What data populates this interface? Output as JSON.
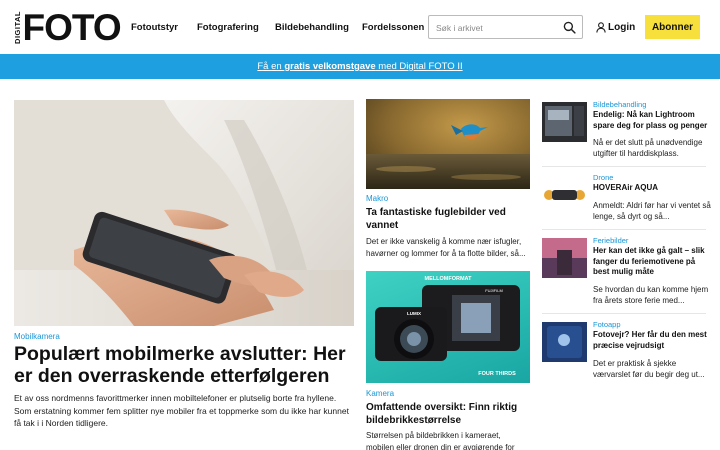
{
  "header": {
    "logo_small": "DIGITAL",
    "logo_big": "FOTO",
    "nav": [
      "Fotoutstyr",
      "Fotografering",
      "Bildebehandling",
      "Fordelssonen"
    ],
    "search_placeholder": "Søk i arkivet",
    "login_label": "Login",
    "subscribe_label": "Abonner"
  },
  "banner": {
    "pre": "Få en ",
    "bold": "gratis velkomstgave",
    "post": " med Digital FOTO II"
  },
  "main_article": {
    "category": "Mobilkamera",
    "title": "Populært mobilmerke avslutter: Her er den overraskende etterfølgeren",
    "description": "Et av oss nordmenns favorittmerker innen mobiltelefoner er plutselig borte fra hyllene. Som erstatning kommer fem splitter nye mobiler fra et toppmerke som du ikke har kunnet få tak i i Norden tidligere."
  },
  "mid_articles": [
    {
      "category": "Makro",
      "title": "Ta fantastiske fuglebilder ved vannet",
      "description": "Det er ikke vanskelig å komme nær isfugler, havørner og lommer for å ta flotte bilder, så..."
    },
    {
      "category": "Kamera",
      "title": "Omfattende oversikt: Finn riktig bildebrikkestørrelse",
      "description": "Størrelsen på bildebrikken i kameraet, mobilen eller dronen din er avgjørende for blant annet...",
      "image_text": {
        "top": "MELLOMFORMAT",
        "brand1": "FUJIFILM",
        "brand2": "LUMIX",
        "bottom": "FOUR THIRDS"
      }
    }
  ],
  "side_articles": [
    {
      "category": "Bildebehandling",
      "title": "Endelig: Nå kan Lightroom spare deg for plass og penger",
      "description": "Nå er det slutt på unødvendige utgifter til harddiskplass."
    },
    {
      "category": "Drone",
      "title": "HOVERAir AQUA",
      "description": "Anmeldt: Aldri før har vi ventet så lenge, så dyrt og så..."
    },
    {
      "category": "Feriebilder",
      "title": "Her kan det ikke gå galt – slik fanger du feriemotivene på best mulig måte",
      "description": "Se hvordan du kan komme hjem fra årets store ferie med..."
    },
    {
      "category": "Fotoapp",
      "title": "Fotovejr? Her får du den mest præcise vejrudsigt",
      "description": "Det er praktisk å sjekke værvarslet før du begir deg ut..."
    }
  ]
}
